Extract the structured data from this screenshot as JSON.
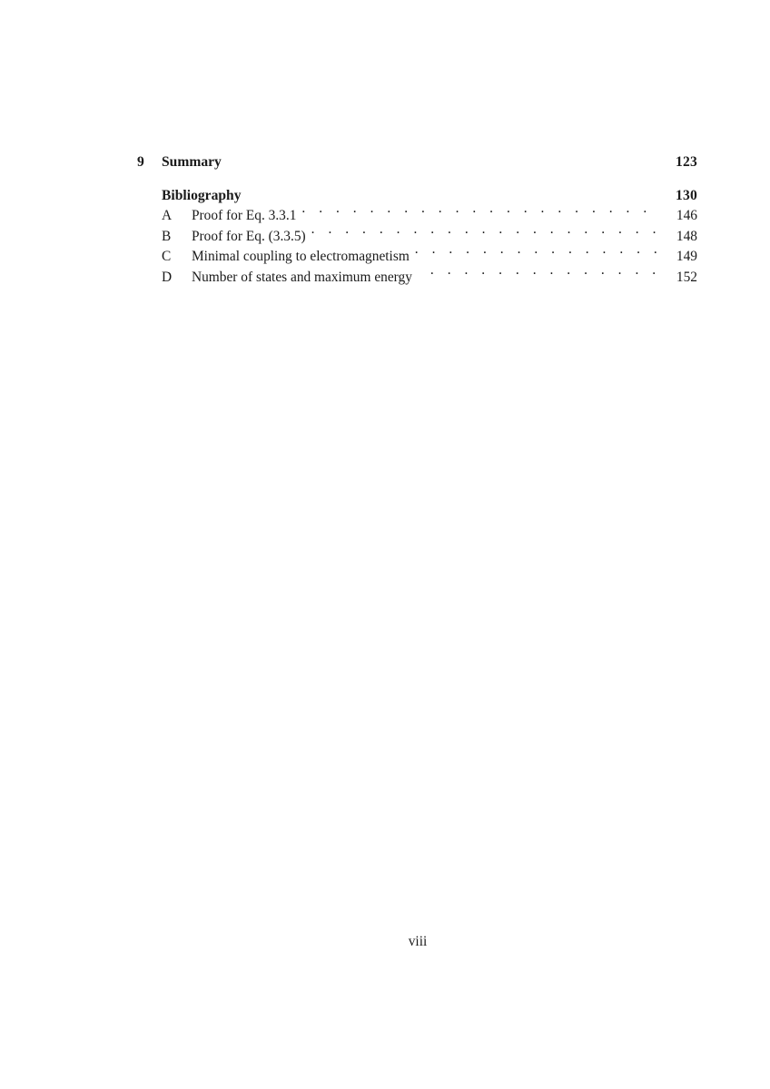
{
  "document": {
    "type": "table-of-contents-continued",
    "folio": "viii"
  },
  "entries": {
    "chapters": [
      {
        "number": "9",
        "title": "Summary",
        "page": "123"
      },
      {
        "number": "",
        "title": "Bibliography",
        "page": "130"
      }
    ],
    "appendices": [
      {
        "label": "A",
        "title": "Proof for Eq. 3.3.1",
        "page": "146"
      },
      {
        "label": "B",
        "title": "Proof for Eq. (3.3.5)",
        "page": "148"
      },
      {
        "label": "C",
        "title": "Minimal coupling to electromagnetism",
        "page": "149"
      },
      {
        "label": "D",
        "title": "Number of states and maximum energy",
        "page": "152"
      }
    ]
  },
  "colors": {
    "page_background": "#ffffff",
    "text": "#1a1a1a"
  }
}
